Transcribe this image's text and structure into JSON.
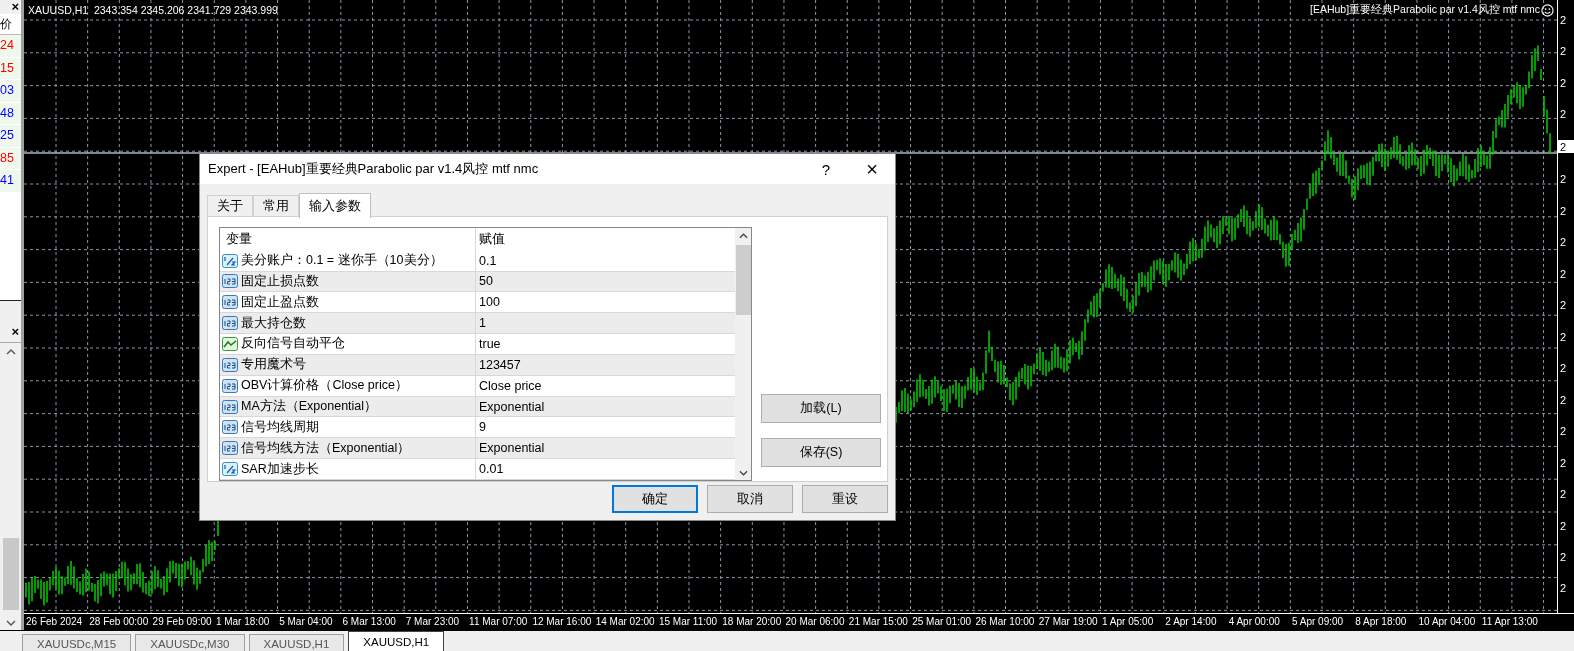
{
  "market_watch": {
    "close": "×",
    "column": "价",
    "prices": [
      {
        "text": "24",
        "color": "#ff0000"
      },
      {
        "text": "15",
        "color": "#ff0000"
      },
      {
        "text": "03",
        "color": "#0000ff"
      },
      {
        "text": "48",
        "color": "#0000ff"
      },
      {
        "text": "25",
        "color": "#0000ff"
      },
      {
        "text": "85",
        "color": "#ff0000"
      },
      {
        "text": "41",
        "color": "#0000ff"
      }
    ]
  },
  "navigator": {
    "close": "×"
  },
  "chart": {
    "symbol_info": "XAUUSD,H1  2343.354 2345.206 2341.729 2343.999",
    "expert_label": "[EAHub]重要经典Parabolic par v1.4风控 mtf nmc",
    "price_axis": [
      {
        "text": "2",
        "current": false
      },
      {
        "text": "2",
        "current": false
      },
      {
        "text": "2",
        "current": false
      },
      {
        "text": "2",
        "current": false
      },
      {
        "text": "2",
        "current": true
      },
      {
        "text": "2",
        "current": false
      },
      {
        "text": "2",
        "current": false
      },
      {
        "text": "2",
        "current": false
      },
      {
        "text": "2",
        "current": false
      },
      {
        "text": "2",
        "current": false
      },
      {
        "text": "2",
        "current": false
      },
      {
        "text": "2",
        "current": false
      },
      {
        "text": "2",
        "current": false
      },
      {
        "text": "2",
        "current": false
      },
      {
        "text": "2",
        "current": false
      },
      {
        "text": "2",
        "current": false
      },
      {
        "text": "2",
        "current": false
      },
      {
        "text": "2",
        "current": false
      },
      {
        "text": "2",
        "current": false
      }
    ],
    "time_axis": [
      "26 Feb 2024",
      "28 Feb 00:00",
      "29 Feb 09:00",
      "1 Mar 18:00",
      "5 Mar 04:00",
      "6 Mar 13:00",
      "7 Mar 23:00",
      "11 Mar 07:00",
      "12 Mar 16:00",
      "14 Mar 02:00",
      "15 Mar 11:00",
      "18 Mar 20:00",
      "20 Mar 06:00",
      "21 Mar 15:00",
      "25 Mar 01:00",
      "26 Mar 10:00",
      "27 Mar 19:00",
      "1 Apr 05:00",
      "2 Apr 14:00",
      "4 Apr 00:00",
      "5 Apr 09:00",
      "8 Apr 18:00",
      "10 Apr 04:00",
      "11 Apr 13:00"
    ]
  },
  "dialog": {
    "title": "Expert - [EAHub]重要经典Parabolic par v1.4风控 mtf nmc",
    "help": "?",
    "close": "×",
    "tabs": [
      {
        "label": "关于",
        "selected": false
      },
      {
        "label": "常用",
        "selected": false
      },
      {
        "label": "输入参数",
        "selected": true
      }
    ],
    "columns": [
      "变量",
      "赋值"
    ],
    "rows": [
      {
        "kind": "double",
        "name": "美分账户：0.1 = 迷你手（10美分）",
        "value": "0.1"
      },
      {
        "kind": "int",
        "name": "固定止损点数",
        "value": "50"
      },
      {
        "kind": "int",
        "name": "固定止盈点数",
        "value": "100"
      },
      {
        "kind": "int",
        "name": "最大持仓数",
        "value": "1"
      },
      {
        "kind": "bool",
        "name": "反向信号自动平仓",
        "value": "true"
      },
      {
        "kind": "int",
        "name": "专用魔术号",
        "value": "123457"
      },
      {
        "kind": "int",
        "name": "OBV计算价格（Close price）",
        "value": "Close price"
      },
      {
        "kind": "int",
        "name": "MA方法（Exponential）",
        "value": "Exponential"
      },
      {
        "kind": "int",
        "name": "信号均线周期",
        "value": "9"
      },
      {
        "kind": "int",
        "name": "信号均线方法（Exponential）",
        "value": "Exponential"
      },
      {
        "kind": "double",
        "name": "SAR加速步长",
        "value": "0.01"
      }
    ],
    "side_buttons": [
      "加载(L)",
      "保存(S)"
    ],
    "buttons": [
      {
        "label": "确定",
        "default": true
      },
      {
        "label": "取消",
        "default": false
      },
      {
        "label": "重设",
        "default": false
      }
    ]
  },
  "chart_tabs": [
    {
      "label": "XAUUSDc,M15",
      "selected": false
    },
    {
      "label": "XAUUSDc,M30",
      "selected": false
    },
    {
      "label": "XAUUSD,H1",
      "selected": false
    },
    {
      "label": "XAUUSD,H1",
      "selected": true
    }
  ]
}
